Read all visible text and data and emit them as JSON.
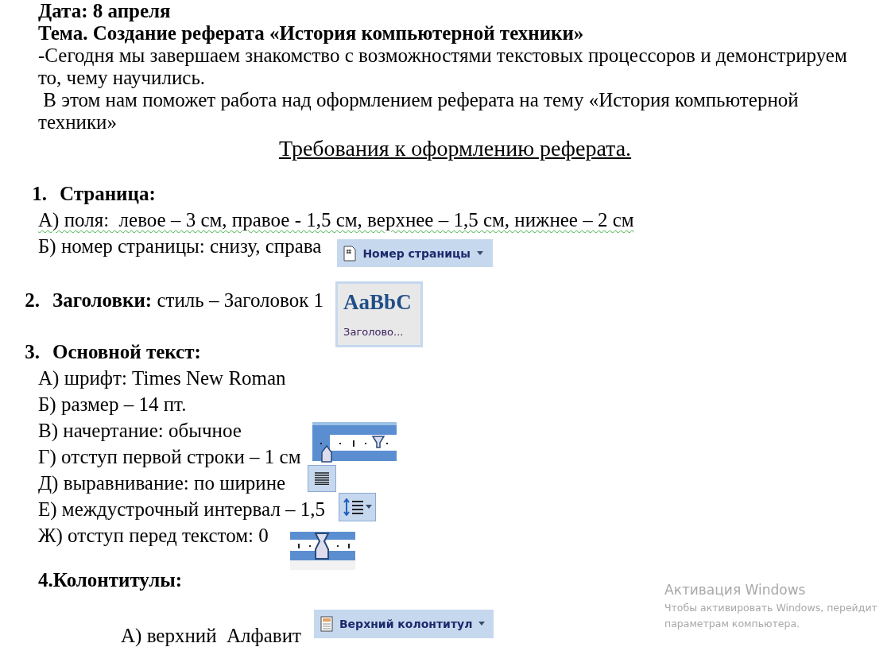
{
  "intro": [
    {
      "kind": "bold",
      "text": "Дата: 8 апреля"
    },
    {
      "kind": "bold",
      "text": "Тема. Создание реферата «История компьютерной техники»"
    },
    {
      "kind": "plain",
      "text": "-Сегодня мы завершаем знакомство с возможностями текстовых процессоров и демонстрируем то, чему научились."
    },
    {
      "kind": "plain",
      "text": " В этом нам поможет работа над оформлением реферата на тему «История компьютерной техники»"
    },
    {
      "kind": "title",
      "text": "Требования к оформлению реферата."
    }
  ],
  "sections": [
    {
      "kind": "list",
      "number": "1.",
      "title": "Страница:",
      "items": [
        {
          "text": "А) поля:  левое – 3 см, правое - 1,5 см, верхнее – 1,5 см, нижнее – 2 см",
          "grammar_flag": true
        },
        {
          "text": "Б) номер страницы: снизу, справа",
          "grammar_flag": false,
          "widget": {
            "kind": "page-number-button",
            "label": "Номер страницы"
          }
        }
      ]
    },
    {
      "kind": "list",
      "number": "2.",
      "title": "Заголовки:",
      "rest": " стиль – Заголовок 1",
      "widget": {
        "kind": "style",
        "sample": "AaBbC",
        "label": "Заголово..."
      }
    },
    {
      "kind": "list",
      "number": "3.",
      "title": "Основной текст:",
      "items": [
        {
          "text": "А) шрифт: Times New Roman",
          "grammar_flag": false
        },
        {
          "text": "Б) размер – 14 пт.",
          "grammar_flag": false
        },
        {
          "text": "В) начертание: обычное",
          "grammar_flag": false
        },
        {
          "text": "Г) отступ первой строки – 1 см",
          "grammar_flag": false,
          "widget": {
            "kind": "first-line-ruler"
          }
        },
        {
          "text": "Д) выравнивание: по ширине",
          "grammar_flag": false,
          "widget": {
            "kind": "justify"
          }
        },
        {
          "text": "Е) междустрочный интервал – 1,5",
          "grammar_flag": false,
          "widget": {
            "kind": "line-spacing"
          }
        },
        {
          "text": "Ж) отступ перед текстом: 0",
          "grammar_flag": false,
          "widget": {
            "kind": "indent-ruler"
          }
        }
      ]
    },
    {
      "kind": "compact",
      "number": "4.",
      "title": "Колонтитулы:",
      "items": [
        {
          "text": "А) верхний  Алфавит",
          "grammar_flag": false,
          "widget": {
            "kind": "header-button",
            "label": "Верхний колонтитул"
          }
        }
      ]
    }
  ],
  "activation": {
    "title": "Активация Windows",
    "line_1": "Чтобы активировать Windows, перейдит",
    "line_2": "параметрам компьютера."
  }
}
